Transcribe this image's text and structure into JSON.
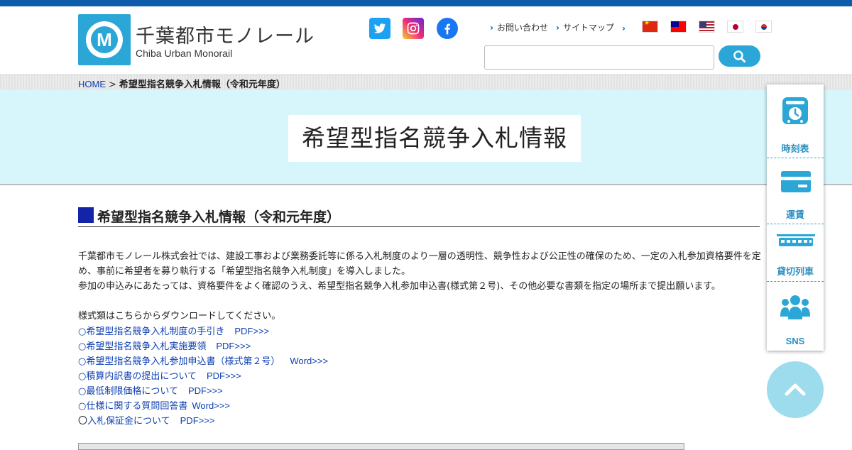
{
  "header": {
    "logo_jp": "千葉都市モノレール",
    "logo_en": "Chiba Urban Monorail",
    "logo_mark": "M",
    "links": [
      "お問い合わせ",
      "サイトマップ"
    ],
    "search_placeholder": "",
    "social": [
      "twitter-icon",
      "instagram-icon",
      "facebook-icon"
    ],
    "flags": [
      "cn",
      "tw",
      "us",
      "jp",
      "kr"
    ]
  },
  "breadcrumb": {
    "home": "HOME",
    "separator": ">",
    "current": "希望型指名競争入札情報（令和元年度）"
  },
  "hero": {
    "title": "希望型指名競争入札情報"
  },
  "section": {
    "heading": "希望型指名競争入札情報（令和元年度）",
    "paragraph1": "千葉都市モノレール株式会社では、建設工事および業務委託等に係る入札制度のより一層の透明性、競争性および公正性の確保のため、一定の入札参加資格要件を定め、事前に希望者を募り執行する「希望型指名競争入札制度」を導入しました。",
    "paragraph2": "参加の申込みにあたっては、資格要件をよく確認のうえ、希望型指名競争入札参加申込書(様式第２号)、その他必要な書類を指定の場所まで提出願います。",
    "lead": "様式類はこちらからダウンロードしてください。",
    "downloads": [
      {
        "bullet": "○",
        "label": "希望型指名競争入札制度の手引き",
        "file": "PDF>>>"
      },
      {
        "bullet": "○",
        "label": "希望型指名競争入札実施要領",
        "file": "PDF>>>"
      },
      {
        "bullet": "○",
        "label": "希望型指名競争入札参加申込書（様式第２号）",
        "file": "Word>>>"
      },
      {
        "bullet": "○",
        "label": "積算内訳書の提出について",
        "file": "PDF>>>"
      },
      {
        "bullet": "○",
        "label": "最低制限価格について",
        "file": "PDF>>>"
      },
      {
        "bullet": "○",
        "label": "仕様に関する質問回答書",
        "file": "Word>>>"
      },
      {
        "bullet": "〇",
        "label": "入札保証金について",
        "file": "PDF>>>"
      }
    ]
  },
  "side_nav": {
    "items": [
      {
        "label": "時刻表",
        "icon": "timetable-icon"
      },
      {
        "label": "運賃",
        "icon": "fare-card-icon"
      },
      {
        "label": "貸切列車",
        "icon": "charter-train-icon"
      },
      {
        "label": "SNS",
        "icon": "people-icon"
      }
    ],
    "back_to_top_icon": "chevron-up-icon"
  },
  "colors": {
    "brand_blue": "#0d5cab",
    "accent_cyan": "#2aa7d6",
    "hero_bg": "#d6f6fc",
    "heading_square": "#1424a8",
    "link": "#0d3fb0"
  }
}
